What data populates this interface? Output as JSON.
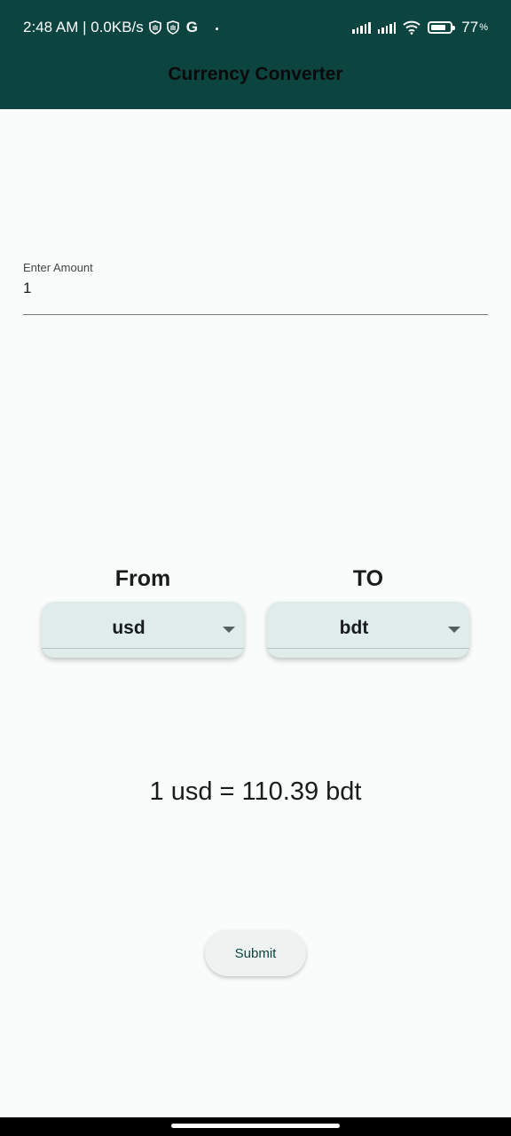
{
  "status_bar": {
    "time_and_speed": "2:48 AM | 0.0KB/s",
    "g_label": "G",
    "battery_percent": "77",
    "battery_unit": "%",
    "battery_level": 0.77
  },
  "app_bar": {
    "title": "Currency Converter"
  },
  "amount_field": {
    "label": "Enter Amount",
    "value": "1"
  },
  "from": {
    "label": "From",
    "selected": "usd"
  },
  "to": {
    "label": "TO",
    "selected": "bdt"
  },
  "result": {
    "text": "1 usd = 110.39 bdt"
  },
  "submit": {
    "label": "Submit"
  },
  "colors": {
    "app_bar": "#0c4540",
    "background": "#f9fcfb",
    "dropdown": "#e0ecea"
  }
}
